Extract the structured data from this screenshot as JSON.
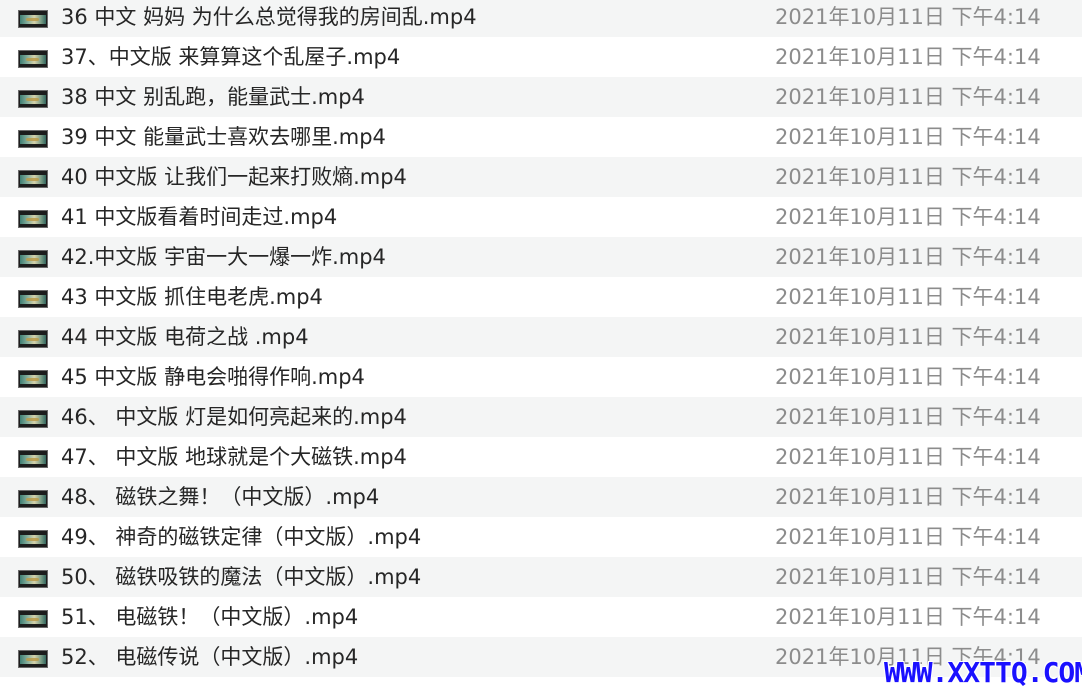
{
  "files": [
    {
      "name": "36 中文 妈妈 为什么总觉得我的房间乱.mp4",
      "date": "2021年10月11日 下午4:14",
      "icon": "video-thumbnail-icon"
    },
    {
      "name": "37、中文版 来算算这个乱屋子.mp4",
      "date": "2021年10月11日 下午4:14",
      "icon": "video-thumbnail-icon"
    },
    {
      "name": "38 中文 别乱跑，能量武士.mp4",
      "date": "2021年10月11日 下午4:14",
      "icon": "video-thumbnail-icon"
    },
    {
      "name": "39  中文 能量武士喜欢去哪里.mp4",
      "date": "2021年10月11日 下午4:14",
      "icon": "video-thumbnail-icon"
    },
    {
      "name": "40 中文版 让我们一起来打败熵.mp4",
      "date": "2021年10月11日 下午4:14",
      "icon": "video-thumbnail-icon"
    },
    {
      "name": "41 中文版看着时间走过.mp4",
      "date": "2021年10月11日 下午4:14",
      "icon": "video-thumbnail-icon"
    },
    {
      "name": "42.中文版 宇宙一大一爆一炸.mp4",
      "date": "2021年10月11日 下午4:14",
      "icon": "video-thumbnail-icon"
    },
    {
      "name": "43 中文版 抓住电老虎.mp4",
      "date": "2021年10月11日 下午4:14",
      "icon": "video-thumbnail-icon"
    },
    {
      "name": "44 中文版 电荷之战 .mp4",
      "date": "2021年10月11日 下午4:14",
      "icon": "video-thumbnail-icon"
    },
    {
      "name": "45 中文版 静电会啪得作响.mp4",
      "date": "2021年10月11日 下午4:14",
      "icon": "video-thumbnail-icon"
    },
    {
      "name": "46、 中文版 灯是如何亮起来的.mp4",
      "date": "2021年10月11日 下午4:14",
      "icon": "video-thumbnail-icon"
    },
    {
      "name": "47、 中文版 地球就是个大磁铁.mp4",
      "date": "2021年10月11日 下午4:14",
      "icon": "video-thumbnail-icon"
    },
    {
      "name": "48、 磁铁之舞！（中文版）.mp4",
      "date": "2021年10月11日 下午4:14",
      "icon": "video-thumbnail-icon"
    },
    {
      "name": "49、 神奇的磁铁定律（中文版）.mp4",
      "date": "2021年10月11日 下午4:14",
      "icon": "video-thumbnail-icon"
    },
    {
      "name": "50、 磁铁吸铁的魔法（中文版）.mp4",
      "date": "2021年10月11日 下午4:14",
      "icon": "video-thumbnail-icon"
    },
    {
      "name": "51、 电磁铁！（中文版）.mp4",
      "date": "2021年10月11日 下午4:14",
      "icon": "video-thumbnail-icon"
    },
    {
      "name": "52、 电磁传说（中文版）.mp4",
      "date": "2021年10月11日 下午4:14",
      "icon": "video-thumbnail-icon"
    }
  ],
  "watermark": "WWW.XXTTQ.COM",
  "colors": {
    "name_text": "#262626",
    "date_text": "#8c8c8c",
    "alt_row": "#f4f5f5",
    "watermark": "#1a10ff"
  }
}
